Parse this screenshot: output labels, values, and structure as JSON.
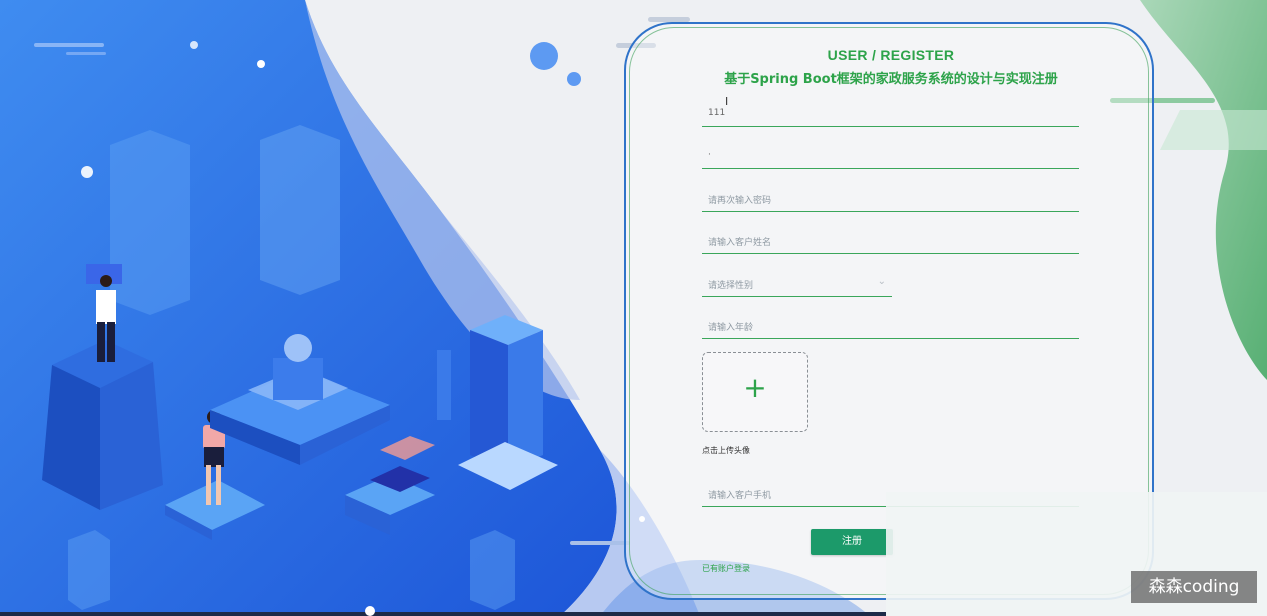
{
  "form": {
    "title": "USER / REGISTER",
    "subtitle": "基于Spring Boot框架的家政服务系统的设计与实现注册",
    "account_value": "111",
    "password_value": "·",
    "confirm_placeholder": "请再次输入密码",
    "name_placeholder": "请输入客户姓名",
    "gender_placeholder": "请选择性别",
    "age_placeholder": "请输入年龄",
    "upload_label": "点击上传头像",
    "phone_placeholder": "请输入客户手机",
    "submit_label": "注册",
    "login_link": "已有账户登录"
  },
  "cursor_glyph": "I",
  "watermark": "森森coding",
  "colors": {
    "accent_green": "#2da34a",
    "card_border": "#2f73c9",
    "submit_bg": "#1c9a6a",
    "bg_blue": "#2a6ae0"
  }
}
